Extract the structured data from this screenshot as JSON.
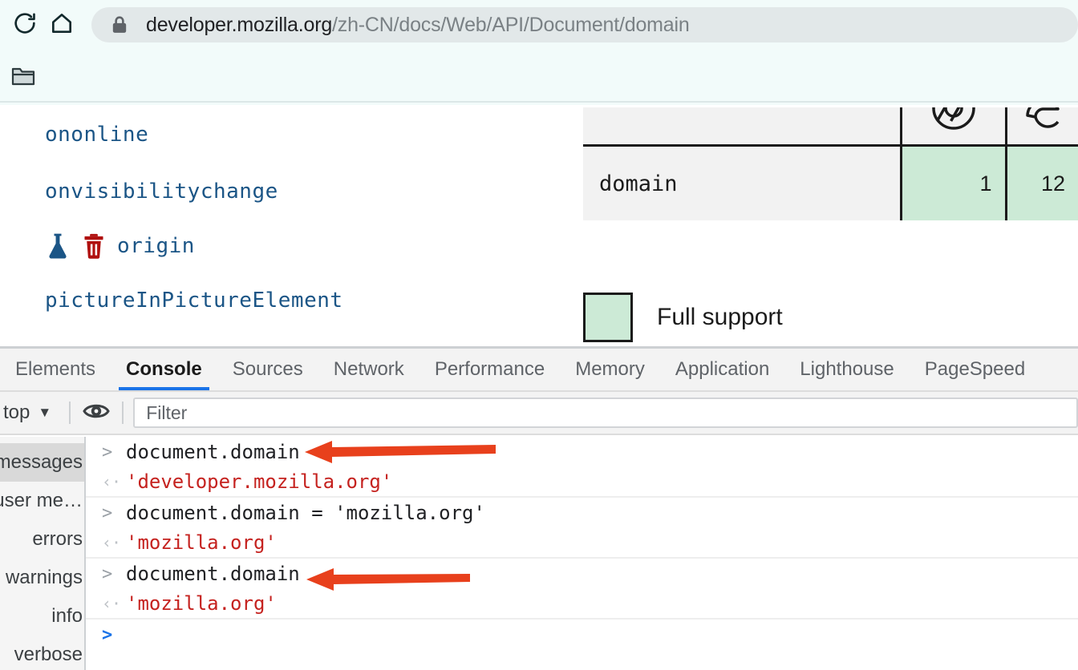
{
  "browser": {
    "reload_icon": "reload-icon",
    "home_icon": "home-icon",
    "lock_icon": "lock-icon",
    "url_domain": "developer.mozilla.org",
    "url_path": "/zh-CN/docs/Web/API/Document/domain",
    "bookmarks_folder_icon": "folder-icon"
  },
  "page": {
    "properties": [
      {
        "name": "ononline",
        "icons": []
      },
      {
        "name": "onvisibilitychange",
        "icons": []
      },
      {
        "name": "origin",
        "icons": [
          "experimental-flask-icon",
          "deprecated-trash-icon"
        ]
      },
      {
        "name": "pictureInPictureElement",
        "icons": []
      }
    ],
    "compat_table": {
      "feature": "domain",
      "values": [
        "1",
        "12"
      ],
      "browser_icons": [
        "chrome-logo-icon",
        "edge-logo-icon"
      ]
    },
    "legend": {
      "swatch_color": "#ccead6",
      "label": "Full support"
    }
  },
  "devtools": {
    "tabs": [
      {
        "label": "Elements",
        "active": false
      },
      {
        "label": "Console",
        "active": true
      },
      {
        "label": "Sources",
        "active": false
      },
      {
        "label": "Network",
        "active": false
      },
      {
        "label": "Performance",
        "active": false
      },
      {
        "label": "Memory",
        "active": false
      },
      {
        "label": "Application",
        "active": false
      },
      {
        "label": "Lighthouse",
        "active": false
      },
      {
        "label": "PageSpeed",
        "active": false
      }
    ],
    "filterbar": {
      "context": "top",
      "context_caret": "▼",
      "eye_icon": "eye-icon",
      "filter_value": "",
      "filter_placeholder": "Filter"
    },
    "sidebar": {
      "items": [
        {
          "label": "messages",
          "selected": true
        },
        {
          "label": "user me…",
          "selected": false
        },
        {
          "label": "errors",
          "selected": false
        },
        {
          "label": "warnings",
          "selected": false
        },
        {
          "label": "info",
          "selected": false
        },
        {
          "label": "verbose",
          "selected": false
        }
      ]
    },
    "console_rows": [
      {
        "kind": "input",
        "glyph": ">",
        "text": "document.domain"
      },
      {
        "kind": "result",
        "glyph": "‹·",
        "text": "'developer.mozilla.org'",
        "group_end": true
      },
      {
        "kind": "input",
        "glyph": ">",
        "text": "document.domain = 'mozilla.org'"
      },
      {
        "kind": "result",
        "glyph": "‹·",
        "text": "'mozilla.org'",
        "group_end": true
      },
      {
        "kind": "input",
        "glyph": ">",
        "text": "document.domain"
      },
      {
        "kind": "result",
        "glyph": "‹·",
        "text": "'mozilla.org'",
        "group_end": true
      },
      {
        "kind": "prompt",
        "glyph": ">",
        "text": ""
      }
    ]
  },
  "annotations": {
    "arrow_color": "#e8401c",
    "arrows": [
      {
        "name": "arrow-annotation-first-domain"
      },
      {
        "name": "arrow-annotation-second-domain"
      }
    ]
  }
}
